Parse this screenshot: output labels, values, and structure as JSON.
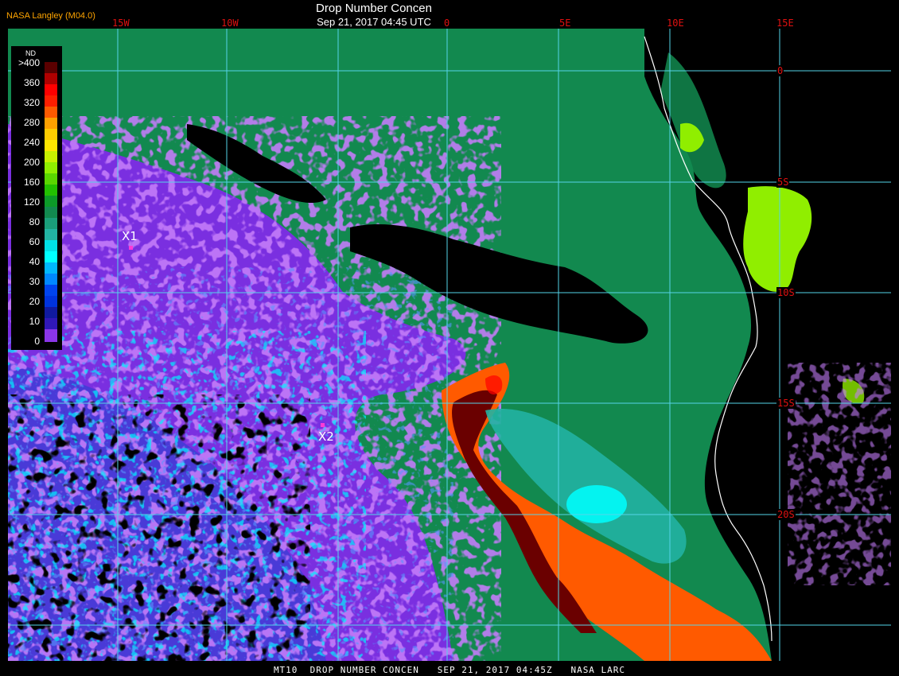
{
  "header": {
    "title": "Drop Number Concen",
    "datetime": "Sep 21, 2017 04:45 UTC",
    "producer": "NASA Langley (M04.0)"
  },
  "grid": {
    "longitude_labels": [
      "15W",
      "10W",
      "0",
      "5E",
      "10E",
      "15E"
    ],
    "latitude_labels": [
      "0",
      "5S",
      "10S",
      "15S",
      "20S"
    ]
  },
  "legend": {
    "title": "ND",
    "labels": [
      ">400",
      "360",
      "320",
      "280",
      "240",
      "200",
      "160",
      "120",
      "80",
      "60",
      "40",
      "30",
      "20",
      "10",
      "0"
    ],
    "colors": [
      "#5a0000",
      "#b00000",
      "#ff0000",
      "#ff5a00",
      "#ffa000",
      "#ffe600",
      "#90ee00",
      "#22c000",
      "#12894f",
      "#22b3a2",
      "#00ffff",
      "#0088ff",
      "#0033dd",
      "#101aa0",
      "#8a35e8",
      "#9b3ee8"
    ]
  },
  "markers": [
    {
      "label": "X1"
    },
    {
      "label": "X2"
    }
  ],
  "footer": "MT10  DROP NUMBER CONCEN   SEP 21, 2017 04:45Z   NASA LARC",
  "colors": {
    "background": "#000000",
    "gridline": "#55d4e8",
    "coastline": "#ffffff",
    "label_red": "#e01010",
    "producer_orange": "#ffa500"
  }
}
